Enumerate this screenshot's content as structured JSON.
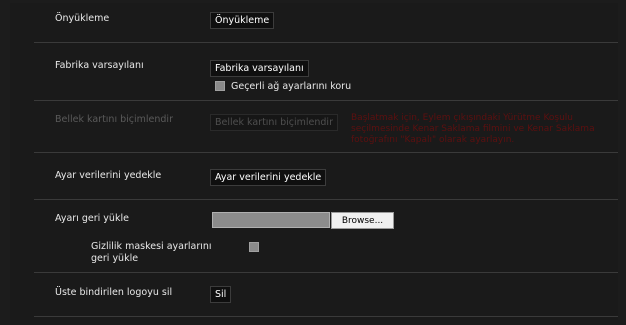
{
  "preset": {
    "label": "Önyükleme",
    "button": "Önyükleme"
  },
  "factory_default": {
    "label": "Fabrika varsayılanı",
    "button": "Fabrika varsayılanı",
    "checkbox_label": "Geçerli ağ ayarlarını koru"
  },
  "memory_card_format": {
    "label": "Bellek kartını biçimlendir",
    "button": "Bellek kartını biçimlendir",
    "note": "Başlatmak için, Eylem çıkışındaki Yürütme Koşulu seçilmesinde Kenar Saklama filmini ve Kenar Saklama fotoğrafını \"Kapalı\" olarak ayarlayın."
  },
  "backup_settings": {
    "label": "Ayar verilerini yedekle",
    "button": "Ayar verilerini yedekle"
  },
  "restore_settings": {
    "label": "Ayarı geri yükle",
    "file_value": "",
    "browse_button": "Browse...",
    "privacy_mask_label_line1": "Gizlilik maskesi ayarlarını",
    "privacy_mask_label_line2": "geri yükle"
  },
  "delete_logo": {
    "label": "Üste bindirilen logoyu sil",
    "button": "Sil"
  },
  "colors": {
    "background": "#1a1a1a",
    "divider": "#3a3a3a",
    "note_text": "#5c1010",
    "disabled_text": "#5a5a5a"
  }
}
